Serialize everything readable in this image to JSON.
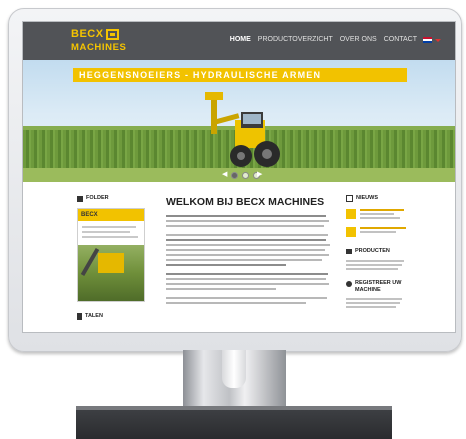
{
  "site": {
    "logo_word": "BECX",
    "logo_sub": "MACHINES",
    "colors": {
      "brand_yellow": "#f5c400",
      "header_bg": "#515357",
      "banner_yellow": "#f2c200"
    }
  },
  "nav": {
    "items": [
      {
        "label": "HOME",
        "active": true
      },
      {
        "label": "PRODUCTOVERZICHT",
        "active": false
      },
      {
        "label": "OVER ONS",
        "active": false
      },
      {
        "label": "CONTACT",
        "active": false
      }
    ],
    "language_flag": "dutch-flag-icon"
  },
  "hero": {
    "banner_text": "HEGGENSNOEIERS - HYDRAULISCHE ARMEN",
    "slides": 3,
    "active_slide": 1
  },
  "sidebar_left": {
    "folder_heading": "FOLDER",
    "folder_brand": "BECX",
    "second_heading": "TALEN"
  },
  "main": {
    "title": "WELKOM BIJ BECX MACHINES"
  },
  "sidebar_right": {
    "news_heading": "NIEUWS",
    "products_heading": "PRODUCTEN",
    "register_heading": "REGISTREER UW MACHINE"
  }
}
